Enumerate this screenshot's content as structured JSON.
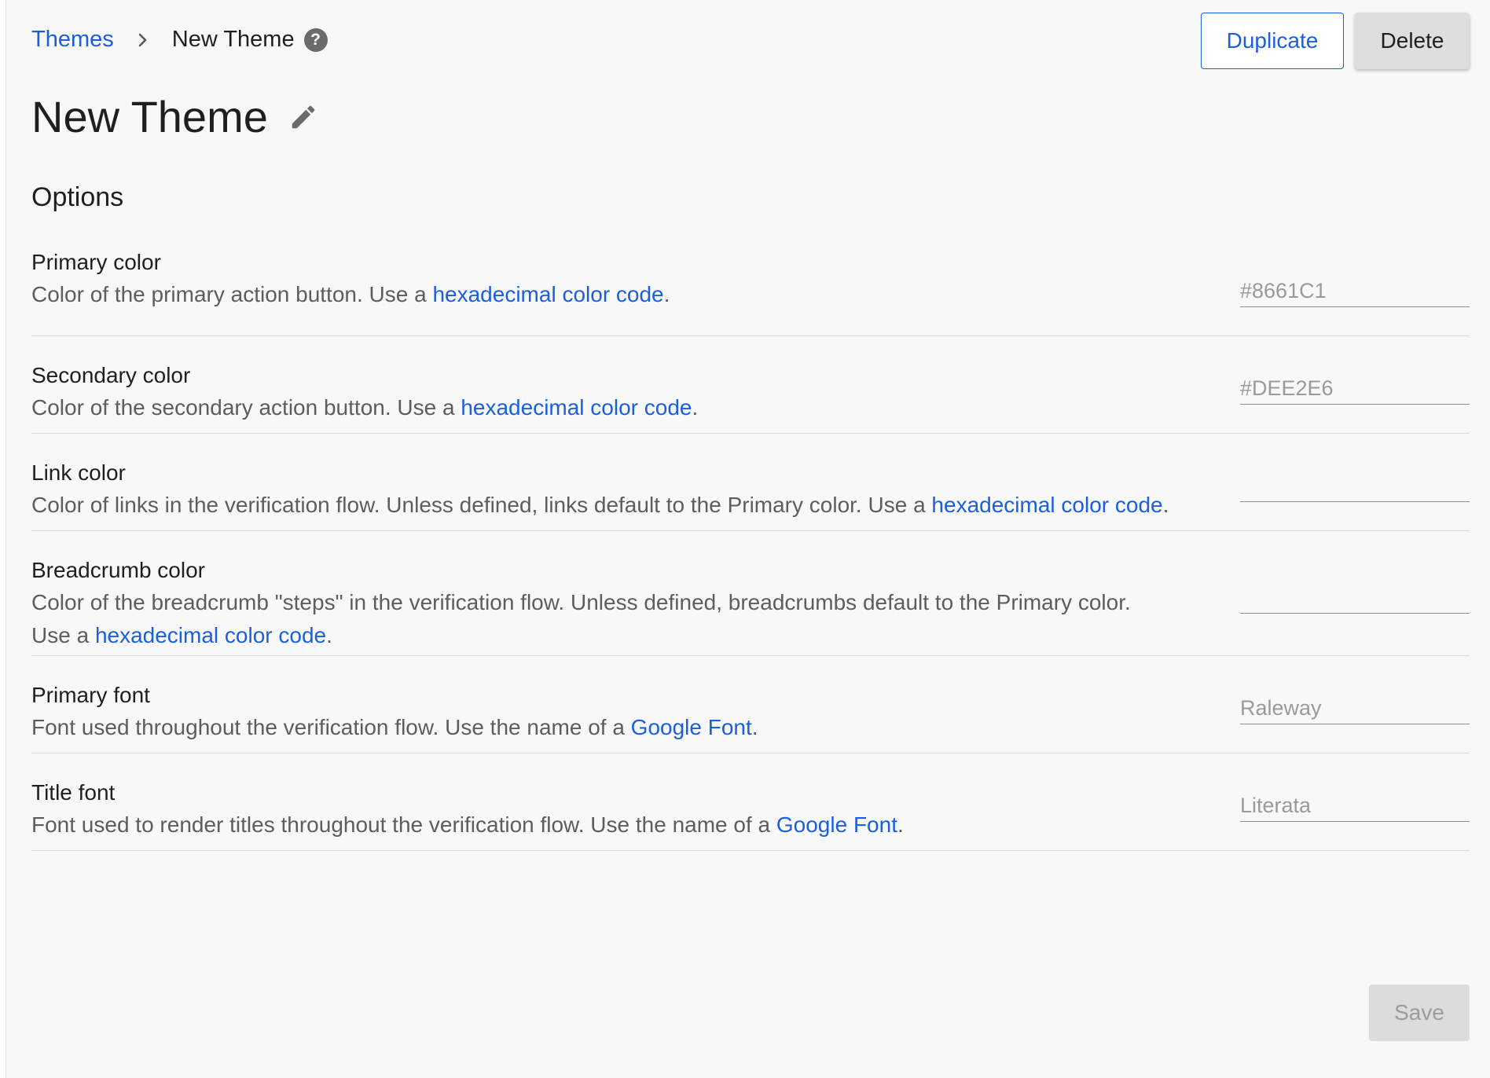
{
  "breadcrumb": {
    "parent": "Themes",
    "current": "New Theme"
  },
  "header": {
    "duplicate_label": "Duplicate",
    "delete_label": "Delete"
  },
  "page": {
    "title": "New Theme",
    "section_title": "Options"
  },
  "options": [
    {
      "label": "Primary color",
      "desc_before": "Color of the primary action button. Use a ",
      "link": "hexadecimal color code",
      "desc_after": ".",
      "placeholder": "#8661C1",
      "value": ""
    },
    {
      "label": "Secondary color",
      "desc_before": "Color of the secondary action button. Use a ",
      "link": "hexadecimal color code",
      "desc_after": ".",
      "placeholder": "#DEE2E6",
      "value": ""
    },
    {
      "label": "Link color",
      "desc_before": "Color of links in the verification flow. Unless defined, links default to the Primary color. Use a ",
      "link": "hexadecimal color code",
      "desc_after": ".",
      "placeholder": "",
      "value": ""
    },
    {
      "label": "Breadcrumb color",
      "desc_line1": "Color of the breadcrumb \"steps\" in the verification flow. Unless defined, breadcrumbs default to the Primary color.",
      "desc_before": "Use a ",
      "link": "hexadecimal color code",
      "desc_after": ".",
      "placeholder": "",
      "value": ""
    },
    {
      "label": "Primary font",
      "desc_before": "Font used throughout the verification flow. Use the name of a ",
      "link": "Google Font",
      "desc_after": ".",
      "placeholder": "Raleway",
      "value": ""
    },
    {
      "label": "Title font",
      "desc_before": "Font used to render titles throughout the verification flow. Use the name of a ",
      "link": "Google Font",
      "desc_after": ".",
      "placeholder": "Literata",
      "value": ""
    }
  ],
  "footer": {
    "save_label": "Save"
  },
  "colors": {
    "link": "#1a5fe0",
    "background": "#f8f8f8",
    "divider": "#dcdcdc",
    "disabled_button": "#dcdcdc"
  },
  "icons": {
    "breadcrumb_separator": "chevron-right-icon",
    "help": "question-circle-icon",
    "edit_title": "pencil-icon"
  }
}
